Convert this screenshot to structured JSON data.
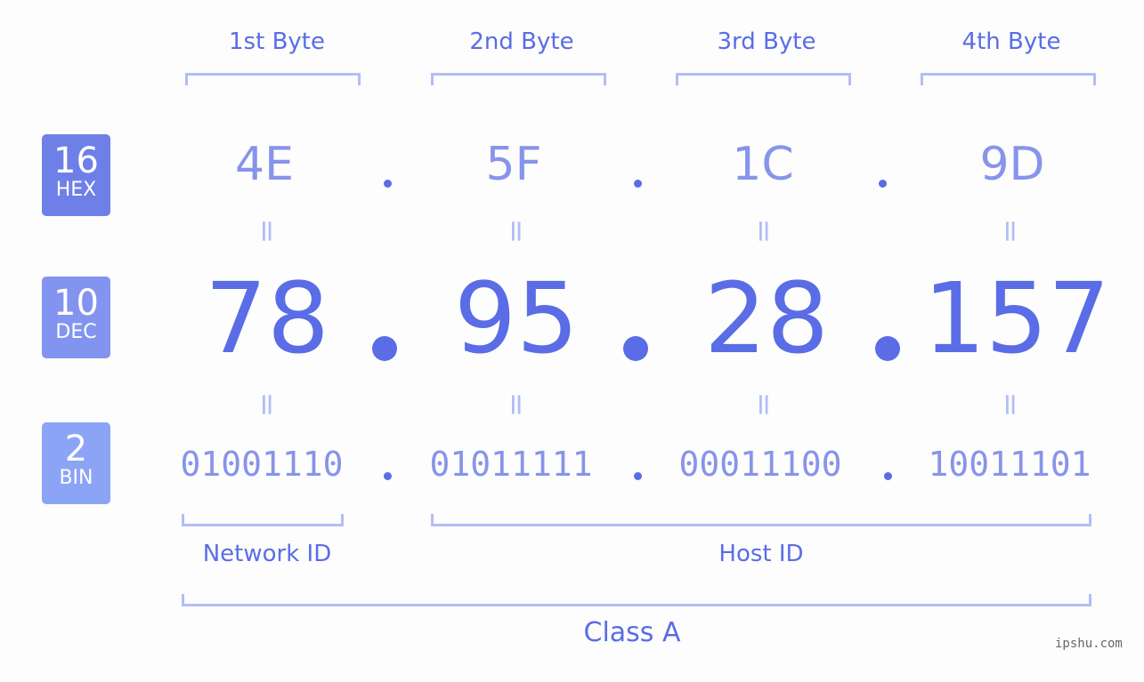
{
  "byte_headers": [
    "1st Byte",
    "2nd Byte",
    "3rd Byte",
    "4th Byte"
  ],
  "badges": {
    "hex": {
      "number": "16",
      "label": "HEX",
      "color": "#6f7fe8"
    },
    "dec": {
      "number": "10",
      "label": "DEC",
      "color": "#8394f0"
    },
    "bin": {
      "number": "2",
      "label": "BIN",
      "color": "#8ca4f6"
    }
  },
  "hex_values": [
    "4E",
    "5F",
    "1C",
    "9D"
  ],
  "dec_values": [
    "78",
    "95",
    "28",
    "157"
  ],
  "bin_values": [
    "01001110",
    "01011111",
    "00011100",
    "10011101"
  ],
  "equals_symbol": "=",
  "network_label": "Network ID",
  "host_label": "Host ID",
  "class_label": "Class A",
  "watermark": "ipshu.com",
  "colors": {
    "accent": "#5a6de6",
    "light": "#8794ea",
    "bracket": "#b3bdf6"
  }
}
